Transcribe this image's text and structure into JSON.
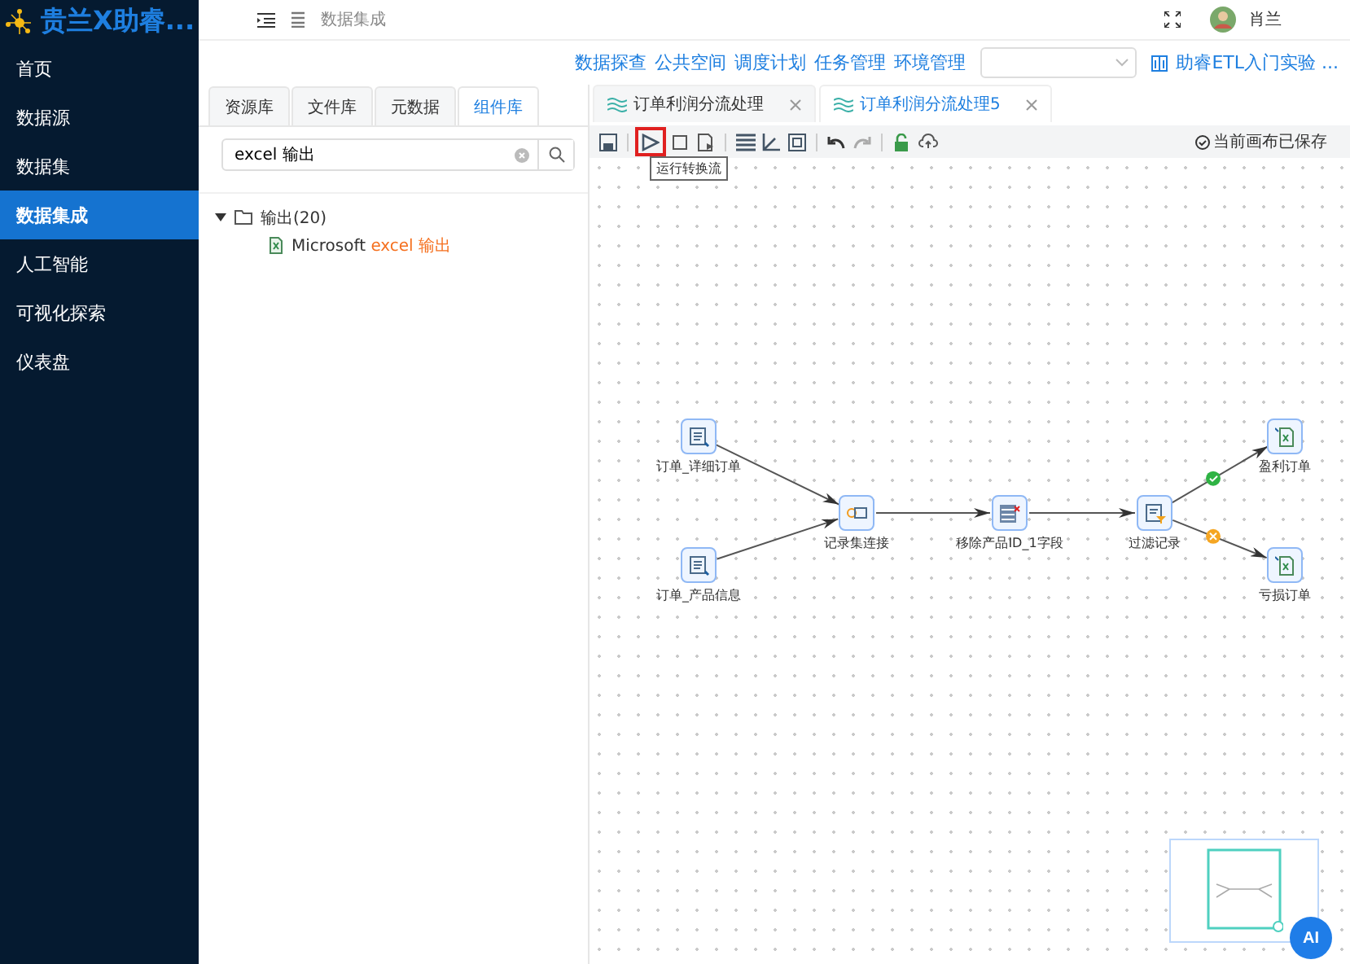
{
  "app": {
    "title": "贵兰X助睿..."
  },
  "header": {
    "breadcrumb": "数据集成",
    "user": "肖兰"
  },
  "sidebar": {
    "items": [
      {
        "label": "首页",
        "selected": false
      },
      {
        "label": "数据源",
        "selected": false
      },
      {
        "label": "数据集",
        "selected": false
      },
      {
        "label": "数据集成",
        "selected": true
      },
      {
        "label": "人工智能",
        "selected": false
      },
      {
        "label": "可视化探索",
        "selected": false
      },
      {
        "label": "仪表盘",
        "selected": false
      }
    ]
  },
  "nav": {
    "links": [
      "数据探查",
      "公共空间",
      "调度计划",
      "任务管理",
      "环境管理"
    ],
    "course": "助睿ETL入门实验 ..."
  },
  "library": {
    "tabs": [
      {
        "label": "资源库",
        "selected": false
      },
      {
        "label": "文件库",
        "selected": false
      },
      {
        "label": "元数据",
        "selected": false
      },
      {
        "label": "组件库",
        "selected": true
      }
    ],
    "search": {
      "value": "excel 输出"
    },
    "tree": [
      {
        "label": "输出(20)",
        "expanded": true,
        "children": [
          {
            "parts": [
              {
                "kind": "plain",
                "text": "Microsoft "
              },
              {
                "kind": "match",
                "text": "excel 输出"
              }
            ]
          }
        ]
      }
    ]
  },
  "editor": {
    "tabs": [
      {
        "label": "订单利润分流处理",
        "selected": false
      },
      {
        "label": "订单利润分流处理5",
        "selected": true
      }
    ],
    "toolbar": {
      "buttons": [
        {
          "kind": "save",
          "highlighted": false
        },
        {
          "kind": "run",
          "highlighted": true
        },
        {
          "kind": "stop",
          "highlighted": false
        },
        {
          "kind": "preview",
          "highlighted": false
        },
        {
          "kind": "grid",
          "highlighted": false
        },
        {
          "kind": "align",
          "highlighted": false
        },
        {
          "kind": "fit",
          "highlighted": false
        },
        {
          "kind": "undo",
          "highlighted": false
        },
        {
          "kind": "redo",
          "highlighted": false
        },
        {
          "kind": "lock",
          "highlighted": false
        },
        {
          "kind": "upload",
          "highlighted": false
        }
      ],
      "tooltip": "运行转换流",
      "status": "当前画布已保存"
    },
    "nodes": [
      {
        "label": "订单_详细订单",
        "kind": "table-input"
      },
      {
        "label": "订单_产品信息",
        "kind": "table-input"
      },
      {
        "label": "记录集连接",
        "kind": "join"
      },
      {
        "label": "移除产品ID_1字段",
        "kind": "remove-field"
      },
      {
        "label": "过滤记录",
        "kind": "filter"
      },
      {
        "label": "盈利订单",
        "kind": "excel-output"
      },
      {
        "label": "亏损订单",
        "kind": "excel-output"
      }
    ],
    "edges": [
      {
        "kind": "plain"
      },
      {
        "kind": "plain"
      },
      {
        "kind": "plain"
      },
      {
        "kind": "plain"
      },
      {
        "kind": "success"
      },
      {
        "kind": "fail"
      }
    ]
  },
  "assistant": {
    "label": "AI"
  }
}
